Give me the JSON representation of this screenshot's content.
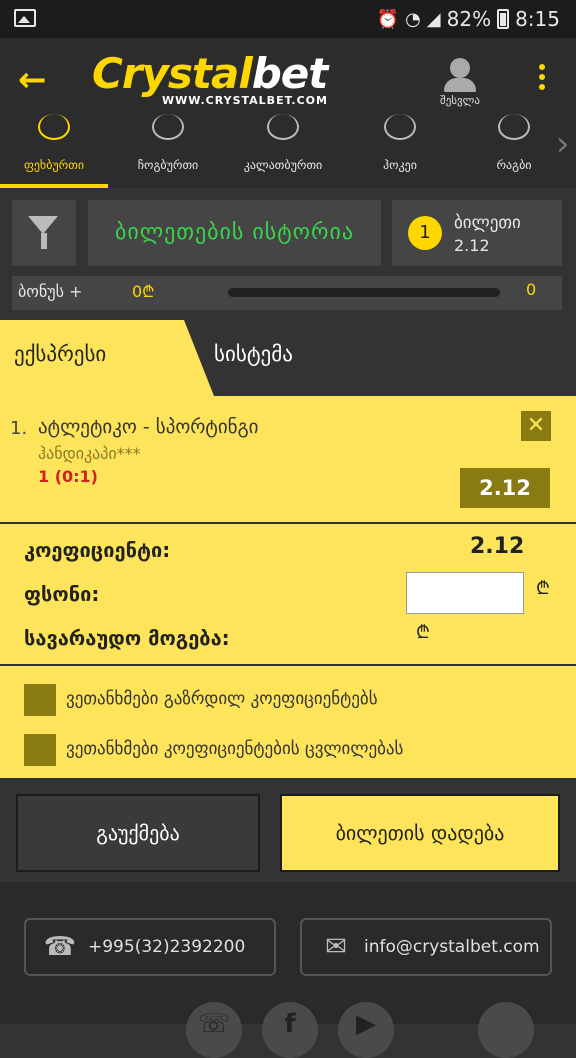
{
  "status_bar": {
    "battery": "82%",
    "time": "8:15"
  },
  "header": {
    "logo_part1": "Crystal",
    "logo_part2": "bet",
    "logo_url": "WWW.CRYSTALBET.COM",
    "login_label": "შესვლა"
  },
  "sports": [
    {
      "label": "ფეხბურთი",
      "icon": "football-icon",
      "active": true
    },
    {
      "label": "ჩოგბურთი",
      "icon": "tennis-icon",
      "active": false
    },
    {
      "label": "კალათბურთი",
      "icon": "basketball-icon",
      "active": false
    },
    {
      "label": "ჰოკეი",
      "icon": "hockey-icon",
      "active": false
    },
    {
      "label": "რაგბი",
      "icon": "rugby-icon",
      "active": false
    }
  ],
  "actions": {
    "history_label": "ბილეთების ისტორია",
    "ticket_count": "1",
    "ticket_label": "ბილეთი",
    "ticket_odd": "2.12"
  },
  "bonus": {
    "label": "ბონუს +",
    "amount": "0₾",
    "value": "0",
    "progress": 0
  },
  "bet_tabs": {
    "express": "ექსპრესი",
    "system": "სისტემა"
  },
  "event": {
    "number": "1.",
    "name": "ატლეტიკო - სპორტინგი",
    "market": "ჰანდიკაპი***",
    "pick": "1 (0:1)",
    "odd": "2.12"
  },
  "summary": {
    "coef_label": "კოეფიციენტი:",
    "coef_value": "2.12",
    "stake_label": "ფსონი:",
    "stake_value": "",
    "currency": "₾",
    "win_label": "სავარაუდო მოგება:"
  },
  "checks": [
    {
      "label": "ვეთანხმები გაზრდილ კოეფიციენტებს"
    },
    {
      "label": "ვეთანხმები კოეფიციენტების ცვლილებას"
    }
  ],
  "buttons": {
    "cancel": "გაუქმება",
    "place": "ბილეთის დადება"
  },
  "footer": {
    "phone": "+995(32)2392200",
    "email": "info@crystalbet.com"
  },
  "colors": {
    "accent": "#fde45a",
    "brand_yellow": "#ffd700",
    "green": "#39d64b",
    "red": "#d32020",
    "dark": "#333333"
  }
}
